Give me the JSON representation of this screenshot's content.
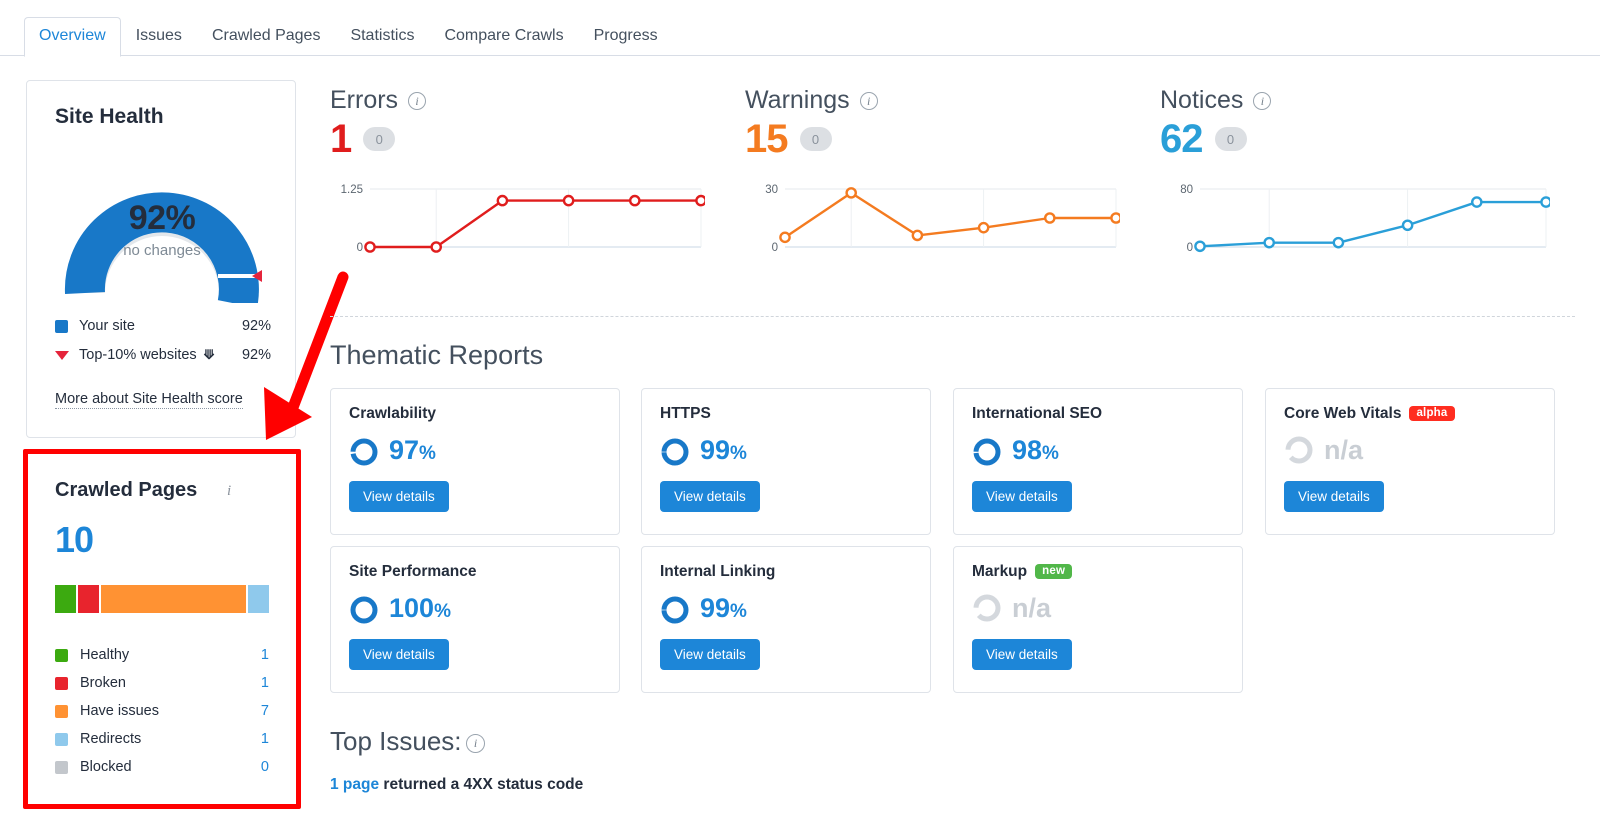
{
  "tabs": [
    {
      "label": "Overview",
      "active": true
    },
    {
      "label": "Issues",
      "active": false
    },
    {
      "label": "Crawled Pages",
      "active": false
    },
    {
      "label": "Statistics",
      "active": false
    },
    {
      "label": "Compare Crawls",
      "active": false
    },
    {
      "label": "Progress",
      "active": false
    }
  ],
  "site_health": {
    "title": "Site Health",
    "percent": "92%",
    "change": "no changes",
    "legend": [
      {
        "label": "Your site",
        "value": "92%",
        "color": "#1878c8"
      },
      {
        "label": "Top-10% websites",
        "value": "92%",
        "color": "#e5243b"
      }
    ],
    "more_link": "More about Site Health score"
  },
  "crawled_pages": {
    "title": "Crawled Pages",
    "info_icon": "info-icon",
    "total": "10",
    "segments": [
      {
        "label": "Healthy",
        "value": "1",
        "color": "#3caa10"
      },
      {
        "label": "Broken",
        "value": "1",
        "color": "#e8242d"
      },
      {
        "label": "Have issues",
        "value": "7",
        "color": "#ff9233"
      },
      {
        "label": "Redirects",
        "value": "1",
        "color": "#8fc9ec"
      },
      {
        "label": "Blocked",
        "value": "0",
        "color": "#c3c7cc"
      }
    ]
  },
  "metrics": [
    {
      "title": "Errors",
      "value": "1",
      "delta": "0",
      "color": "#e01d1d",
      "chart_index": 0
    },
    {
      "title": "Warnings",
      "value": "15",
      "delta": "0",
      "color": "#f47b20",
      "chart_index": 1
    },
    {
      "title": "Notices",
      "value": "62",
      "delta": "0",
      "color": "#2a9fd8",
      "chart_index": 2
    }
  ],
  "chart_data": [
    {
      "type": "line",
      "title": "Errors",
      "x": [
        1,
        2,
        3,
        4,
        5,
        6
      ],
      "values": [
        0,
        0,
        1,
        1,
        1,
        1
      ],
      "ylim": [
        0,
        1.25
      ],
      "ytick_labels": [
        "0",
        "1.25"
      ],
      "xlabel": "",
      "ylabel": "",
      "color": "#e01d1d",
      "grid": true,
      "legend": "none"
    },
    {
      "type": "line",
      "title": "Warnings",
      "x": [
        1,
        2,
        3,
        4,
        5,
        6
      ],
      "values": [
        5,
        28,
        6,
        10,
        15,
        15
      ],
      "ylim": [
        0,
        30
      ],
      "ytick_labels": [
        "0",
        "30"
      ],
      "xlabel": "",
      "ylabel": "",
      "color": "#f47b20",
      "grid": true,
      "legend": "none"
    },
    {
      "type": "line",
      "title": "Notices",
      "x": [
        1,
        2,
        3,
        4,
        5,
        6
      ],
      "values": [
        1,
        6,
        6,
        30,
        62,
        62
      ],
      "ylim": [
        0,
        80
      ],
      "ytick_labels": [
        "0",
        "80"
      ],
      "xlabel": "",
      "ylabel": "",
      "color": "#2a9fd8",
      "grid": true,
      "legend": "none"
    }
  ],
  "thematic": {
    "heading": "Thematic Reports",
    "button_label": "View details",
    "cards": [
      {
        "name": "Crawlability",
        "value": "97",
        "unit": "%",
        "badge": null,
        "na": false
      },
      {
        "name": "HTTPS",
        "value": "99",
        "unit": "%",
        "badge": null,
        "na": false
      },
      {
        "name": "International SEO",
        "value": "98",
        "unit": "%",
        "badge": null,
        "na": false
      },
      {
        "name": "Core Web Vitals",
        "value": "n/a",
        "unit": "",
        "badge": "alpha",
        "na": true
      },
      {
        "name": "Site Performance",
        "value": "100",
        "unit": "%",
        "badge": null,
        "na": false
      },
      {
        "name": "Internal Linking",
        "value": "99",
        "unit": "%",
        "badge": null,
        "na": false
      },
      {
        "name": "Markup",
        "value": "n/a",
        "unit": "",
        "badge": "new",
        "na": true
      }
    ]
  },
  "top_issues": {
    "heading": "Top Issues:",
    "info_icon": "info-icon",
    "items": [
      {
        "link": "1 page",
        "text": " returned a 4XX status code"
      }
    ]
  },
  "annotation": {
    "highlight_color": "#ff0000",
    "arrow_color": "#ff0000"
  }
}
